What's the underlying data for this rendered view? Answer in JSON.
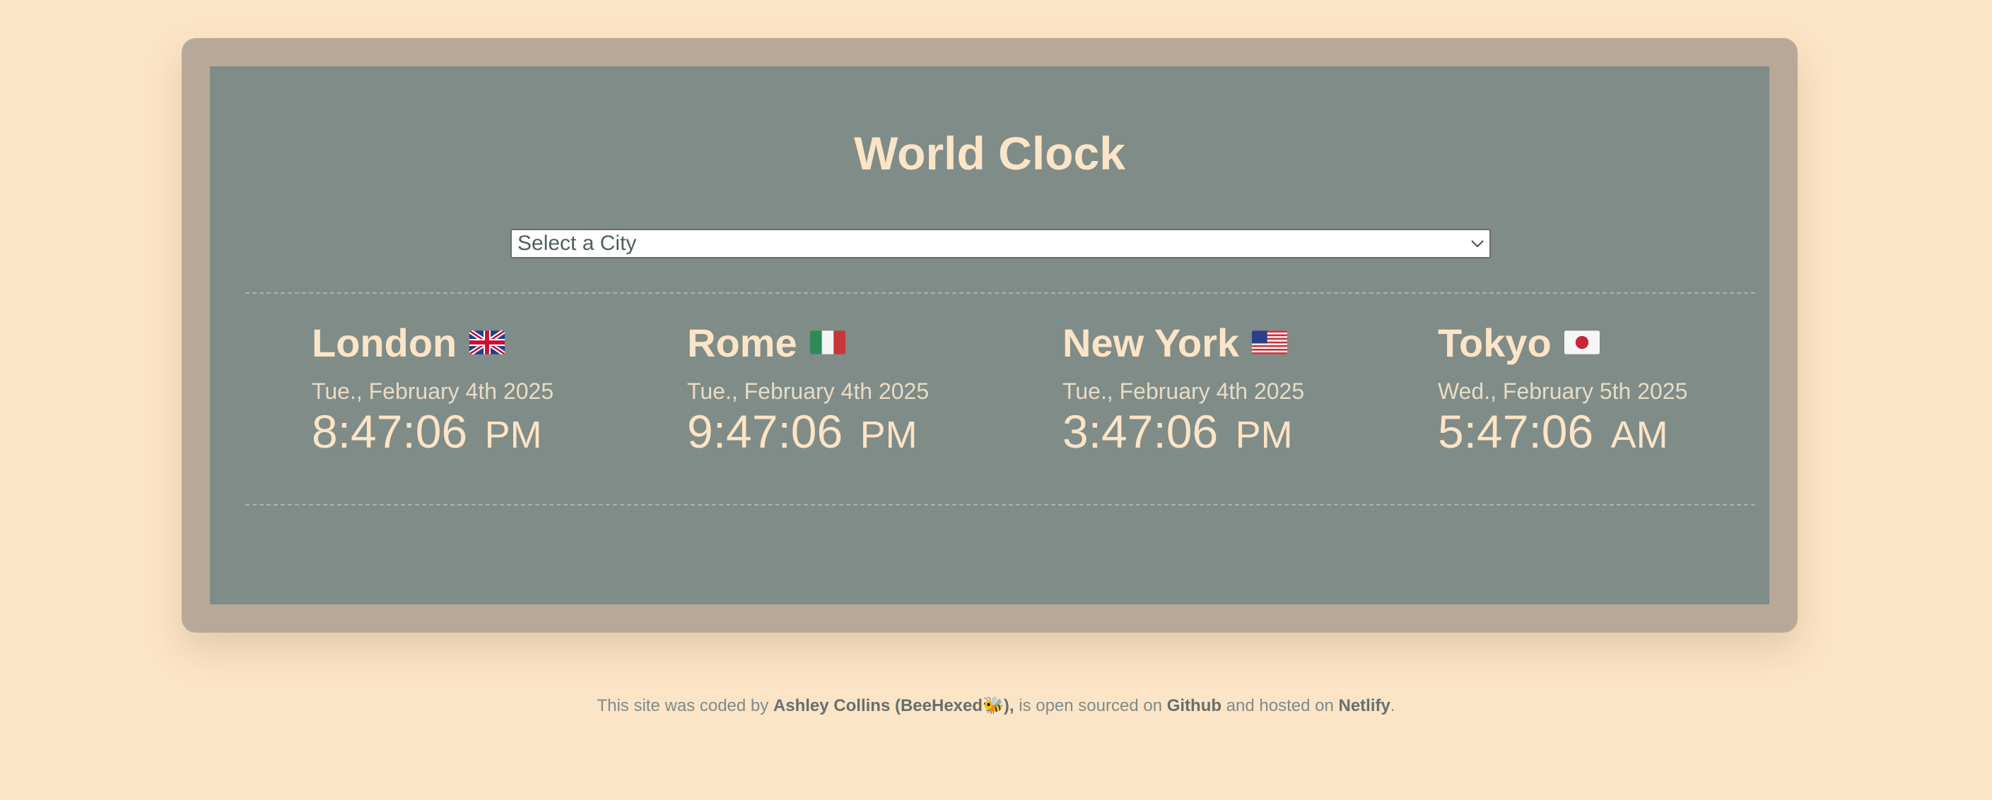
{
  "app": {
    "title": "World Clock"
  },
  "city_select": {
    "selected": "Select a City"
  },
  "cities": [
    {
      "name": "London",
      "flag_icon": "uk-flag-icon",
      "date": "Tue., February 4th 2025",
      "time": "8:47:06",
      "ampm": "PM"
    },
    {
      "name": "Rome",
      "flag_icon": "italy-flag-icon",
      "date": "Tue., February 4th 2025",
      "time": "9:47:06",
      "ampm": "PM"
    },
    {
      "name": "New York",
      "flag_icon": "us-flag-icon",
      "date": "Tue., February 4th 2025",
      "time": "3:47:06",
      "ampm": "PM"
    },
    {
      "name": "Tokyo",
      "flag_icon": "japan-flag-icon",
      "date": "Wed., February 5th 2025",
      "time": "5:47:06",
      "ampm": "AM"
    }
  ],
  "footer": {
    "text_1": "This site was coded by ",
    "author_link": "Ashley Collins (BeeHexed🐝),",
    "text_2": " is open sourced on ",
    "github_link": "Github",
    "text_3": " and hosted on ",
    "netlify_link": "Netlify",
    "text_4": "."
  },
  "colors": {
    "page_background": "#fce4c6",
    "frame": "#b8a898",
    "panel": "#7f8c88",
    "accent_text": "#fce4c6"
  }
}
